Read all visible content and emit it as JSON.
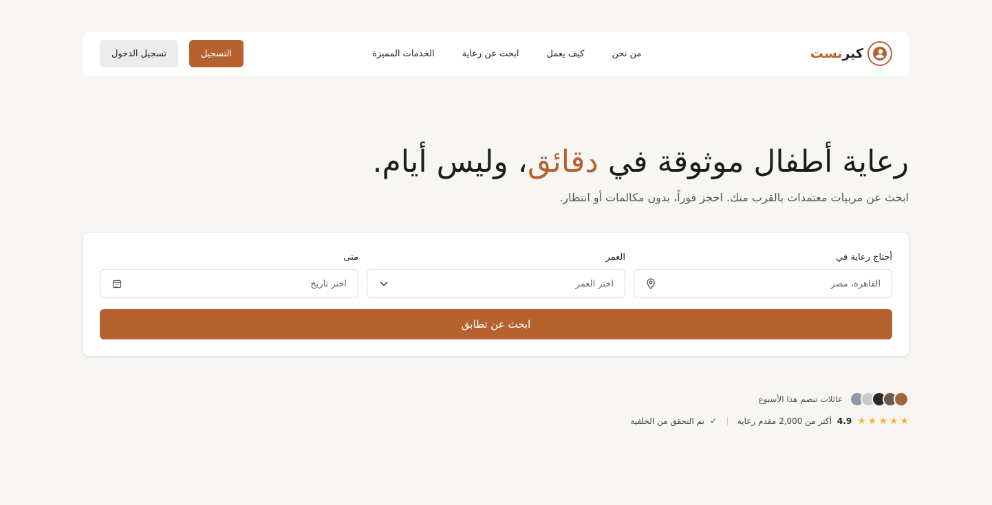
{
  "header": {
    "logo": {
      "brand_dark": "كير",
      "brand_accent": "نست"
    },
    "nav": [
      {
        "label": "من نحن"
      },
      {
        "label": "كيف يعمل"
      },
      {
        "label": "ابحث عن رعاية"
      },
      {
        "label": "الخدمات المميزة"
      }
    ],
    "login_label": "تسجيل الدخول",
    "register_label": "التسجيل"
  },
  "hero": {
    "title_before": "رعاية أطفال موثوقة في ",
    "title_accent": "دقائق",
    "title_after": "، وليس أيام.",
    "subtitle": "ابحث عن مربيات معتمدات بالقرب منك. احجز فوراً، بدون مكالمات أو انتظار."
  },
  "search": {
    "location_label": "أحتاج رعاية في",
    "location_placeholder": "القاهرة، مصر",
    "age_label": "العمر",
    "age_placeholder": "اختر العمر",
    "when_label": "متى",
    "when_placeholder": "اختر تاريخ",
    "submit_label": "ابحث عن تطابق"
  },
  "social_proof": {
    "joining_text": "عائلات تنضم هذا الأسبوع",
    "rating": "4.9",
    "providers_text": "أكثر من 2,000 مقدم رعاية",
    "verified_text": "تم التحقق من الخلفية"
  },
  "colors": {
    "accent": "#b5622f",
    "background": "#f8f6f3",
    "star": "#f2b33a"
  }
}
